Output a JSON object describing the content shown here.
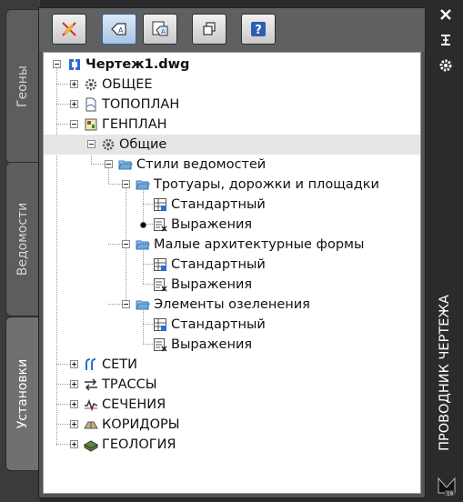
{
  "side_tabs": [
    {
      "label": "Геоны",
      "active": false
    },
    {
      "label": "Ведомости",
      "active": false
    },
    {
      "label": "Установки",
      "active": true
    }
  ],
  "toolbar": {
    "buttons": [
      {
        "icon": "pencil-cross-icon",
        "active": false
      },
      {
        "icon": "tag-icon",
        "active": true
      },
      {
        "icon": "tag-list-icon",
        "active": false
      },
      {
        "icon": "stack-icon",
        "active": false
      },
      {
        "icon": "help-icon",
        "glyph": "?",
        "active": false
      }
    ]
  },
  "tree": {
    "nodes": [
      {
        "label": "Чертеж1.dwg",
        "icon": "drawing-icon",
        "bold": true,
        "expander": "minus"
      },
      {
        "label": "ОБЩЕЕ",
        "icon": "gear-icon",
        "expander": "plus"
      },
      {
        "label": "ТОПОПЛАН",
        "icon": "document-icon",
        "expander": "plus"
      },
      {
        "label": "ГЕНПЛАН",
        "icon": "plan-icon",
        "expander": "minus"
      },
      {
        "label": "Общие",
        "icon": "gear-icon",
        "expander": "minus",
        "selected": true
      },
      {
        "label": "Стили ведомостей",
        "icon": "folder-icon",
        "expander": "minus"
      },
      {
        "label": "Тротуары, дорожки и площадки",
        "icon": "folder-icon",
        "expander": "minus"
      },
      {
        "label": "Стандартный",
        "icon": "table-icon"
      },
      {
        "label": "Выражения",
        "icon": "expression-icon",
        "marked": true
      },
      {
        "label": "Малые архитектурные формы",
        "icon": "folder-icon",
        "expander": "minus"
      },
      {
        "label": "Стандартный",
        "icon": "table-icon"
      },
      {
        "label": "Выражения",
        "icon": "expression-icon"
      },
      {
        "label": "Элементы озеленения",
        "icon": "folder-icon",
        "expander": "minus"
      },
      {
        "label": "Стандартный",
        "icon": "table-icon"
      },
      {
        "label": "Выражения",
        "icon": "expression-icon"
      },
      {
        "label": "СЕТИ",
        "icon": "network-icon",
        "expander": "plus"
      },
      {
        "label": "ТРАССЫ",
        "icon": "route-icon",
        "expander": "plus"
      },
      {
        "label": "СЕЧЕНИЯ",
        "icon": "section-icon",
        "expander": "plus"
      },
      {
        "label": "КОРИДОРЫ",
        "icon": "corridor-icon",
        "expander": "plus"
      },
      {
        "label": "ГЕОЛОГИЯ",
        "icon": "geology-icon",
        "expander": "plus"
      }
    ]
  },
  "right_bar": {
    "title": "ПРОВОДНИК ЧЕРТЕЖА",
    "buttons": [
      {
        "icon": "close-icon"
      },
      {
        "icon": "autohide-icon"
      },
      {
        "icon": "properties-icon"
      }
    ],
    "badge_number": "19"
  },
  "colors": {
    "selected_row": "#e6e6e6",
    "folder": "#6fa8dc",
    "active_button": "#a9c4e3"
  }
}
